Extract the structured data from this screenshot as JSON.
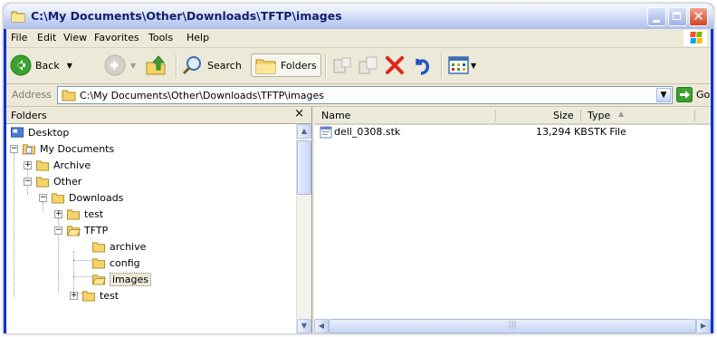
{
  "window": {
    "title": "C:\\My Documents\\Other\\Downloads\\TFTP\\images",
    "icon": "folder-icon",
    "controls": [
      "minimize-icon",
      "maximize-icon",
      "close-icon"
    ]
  },
  "menu": [
    "File",
    "Edit",
    "View",
    "Favorites",
    "Tools",
    "Help"
  ],
  "toolbar": {
    "back_label": "Back",
    "search_label": "Search",
    "folders_label": "Folders",
    "icons": [
      "back-arrow-icon",
      "forward-arrow-icon",
      "up-folder-icon",
      "search-icon",
      "folders-icon",
      "move-to-icon",
      "copy-to-icon",
      "delete-icon",
      "undo-icon",
      "views-icon"
    ]
  },
  "address": {
    "label": "Address",
    "value": "C:\\My Documents\\Other\\Downloads\\TFTP\\images",
    "go_label": "Go"
  },
  "folders_pane": {
    "title": "Folders",
    "close": "×",
    "tree": [
      {
        "label": "Desktop",
        "depth": 0,
        "toggle": ""
      },
      {
        "label": "My Documents",
        "depth": 1,
        "toggle": "−"
      },
      {
        "label": "Archive",
        "depth": 2,
        "toggle": "+"
      },
      {
        "label": "Other",
        "depth": 2,
        "toggle": "−"
      },
      {
        "label": "Downloads",
        "depth": 3,
        "toggle": "−"
      },
      {
        "label": "test",
        "depth": 4,
        "toggle": "+"
      },
      {
        "label": "TFTP",
        "depth": 4,
        "toggle": "−"
      },
      {
        "label": "archive",
        "depth": 5,
        "toggle": ""
      },
      {
        "label": "config",
        "depth": 5,
        "toggle": ""
      },
      {
        "label": "images",
        "depth": 5,
        "toggle": "",
        "selected": true
      },
      {
        "label": "test",
        "depth": 4,
        "toggle": "+"
      }
    ]
  },
  "file_list": {
    "columns": {
      "name": "Name",
      "size": "Size",
      "type": "Type"
    },
    "rows": [
      {
        "name": "dell_0308.stk",
        "size": "13,294 KB",
        "type": "STK File"
      }
    ]
  }
}
